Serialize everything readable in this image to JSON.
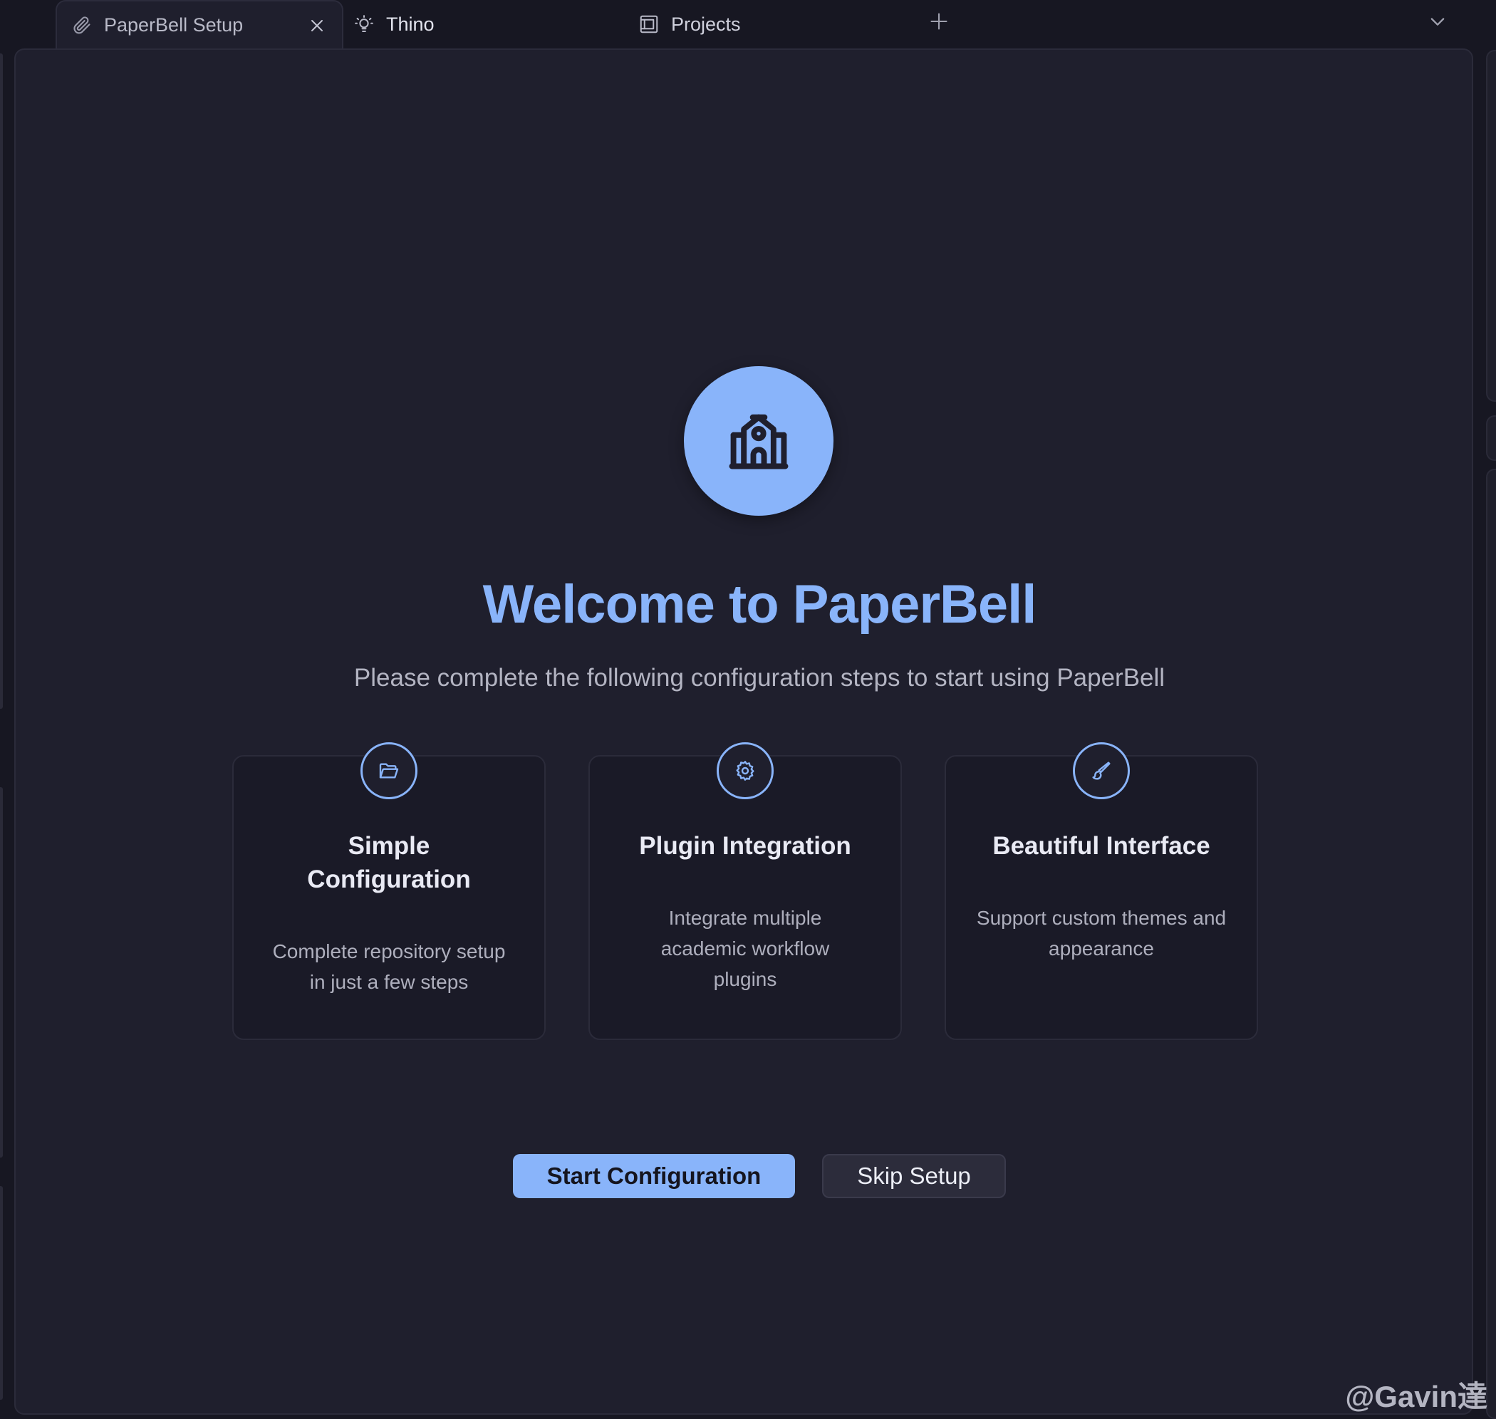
{
  "tabs": [
    {
      "label": "PaperBell Setup",
      "icon": "paperclip-icon",
      "active": true
    },
    {
      "label": "Thino",
      "icon": "lightbulb-icon",
      "active": false
    },
    {
      "label": "Projects",
      "icon": "projects-icon",
      "active": false
    }
  ],
  "welcome": {
    "title": "Welcome to PaperBell",
    "subtitle": "Please complete the following configuration steps to start using PaperBell",
    "hero_icon": "school-building-icon"
  },
  "features": [
    {
      "title": "Simple Configuration",
      "description": "Complete repository setup in just a few steps",
      "icon": "folder-open-icon"
    },
    {
      "title": "Plugin Integration",
      "description": "Integrate multiple academic workflow plugins",
      "icon": "gear-icon"
    },
    {
      "title": "Beautiful Interface",
      "description": "Support custom themes and appearance",
      "icon": "paintbrush-icon"
    }
  ],
  "buttons": {
    "start": "Start Configuration",
    "skip": "Skip Setup"
  },
  "watermark": "@Gavin達",
  "colors": {
    "accent": "#89b4fa",
    "background": "#1f1f2d",
    "tabbar": "#171722",
    "card": "#1a1a27"
  }
}
